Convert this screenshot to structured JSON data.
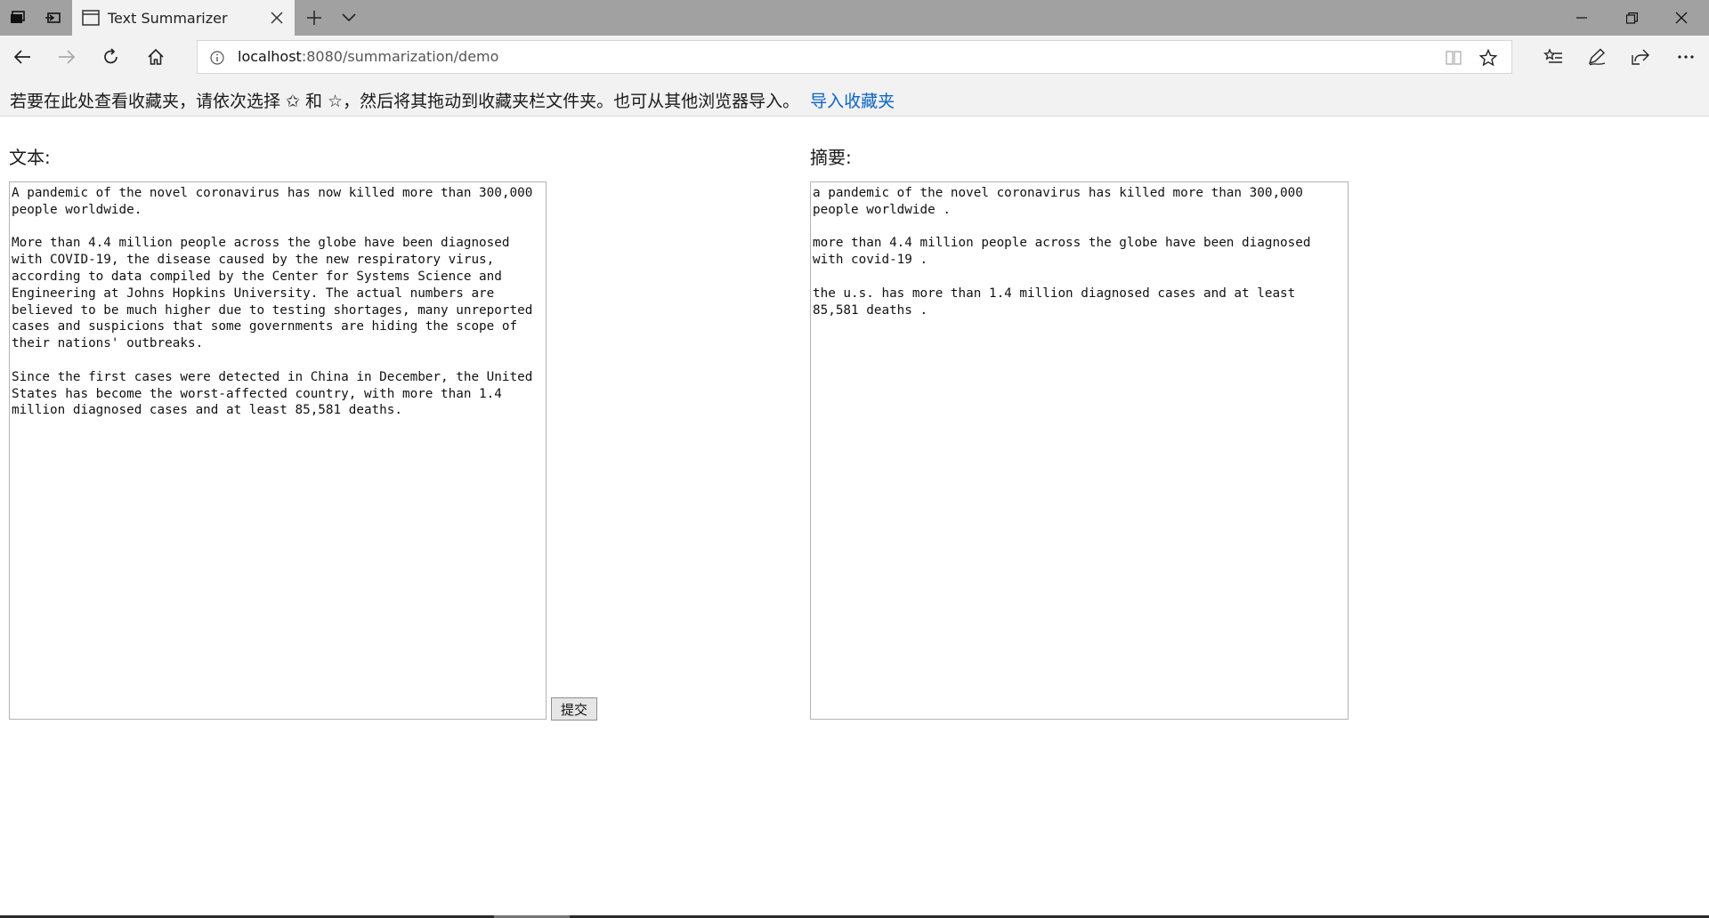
{
  "tab": {
    "title": "Text Summarizer"
  },
  "address": {
    "host": "localhost",
    "path": ":8080/summarization/demo"
  },
  "favorites_bar": {
    "hint": "若要在此处查看收藏夹，请依次选择 ✩ 和 ☆，然后将其拖动到收藏夹栏文件夹。也可从其他浏览器导入。",
    "import_link": "导入收藏夹"
  },
  "form": {
    "text_label": "文本:",
    "summary_label": "摘要:",
    "submit_label": "提交",
    "text_value": "A pandemic of the novel coronavirus has now killed more than 300,000\npeople worldwide.\n\nMore than 4.4 million people across the globe have been diagnosed\nwith COVID-19, the disease caused by the new respiratory virus,\naccording to data compiled by the Center for Systems Science and\nEngineering at Johns Hopkins University. The actual numbers are\nbelieved to be much higher due to testing shortages, many unreported\ncases and suspicions that some governments are hiding the scope of\ntheir nations' outbreaks.\n\nSince the first cases were detected in China in December, the United\nStates has become the worst-affected country, with more than 1.4\nmillion diagnosed cases and at least 85,581 deaths.",
    "summary_value": "a pandemic of the novel coronavirus has killed more than 300,000\npeople worldwide .\n\nmore than 4.4 million people across the globe have been diagnosed\nwith covid-19 .\n\nthe u.s. has more than 1.4 million diagnosed cases and at least\n85,581 deaths ."
  }
}
